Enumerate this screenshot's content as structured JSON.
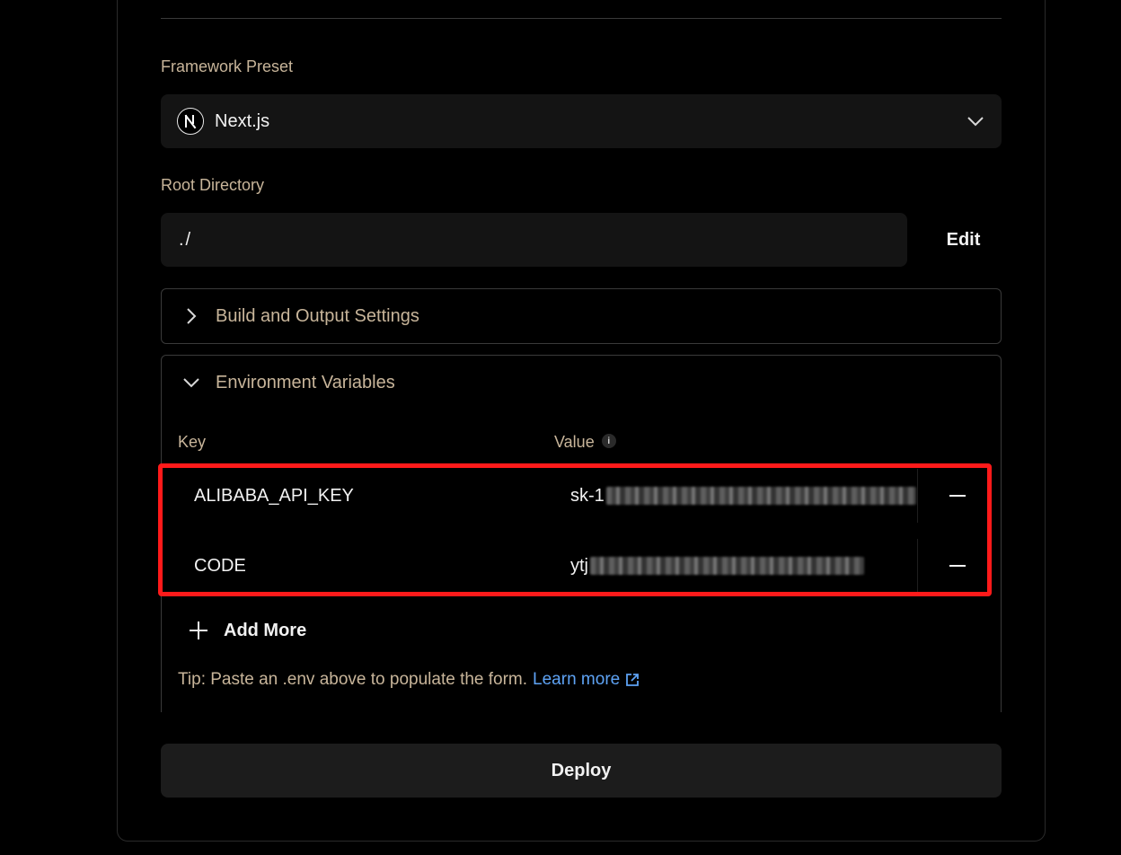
{
  "framework": {
    "label": "Framework Preset",
    "selected": "Next.js",
    "logo_icon": "nextjs-logo-icon"
  },
  "root_directory": {
    "label": "Root Directory",
    "value": "./",
    "edit_label": "Edit"
  },
  "build_settings": {
    "title": "Build and Output Settings",
    "expanded": false
  },
  "env": {
    "title": "Environment Variables",
    "expanded": true,
    "key_header": "Key",
    "value_header": "Value",
    "rows": [
      {
        "key": "ALIBABA_API_KEY",
        "value_visible": "sk-1"
      },
      {
        "key": "CODE",
        "value_visible": "ytj"
      }
    ],
    "add_more_label": "Add More",
    "tip_text": "Tip: Paste an .env above to populate the form.",
    "tip_link": "Learn more"
  },
  "deploy_label": "Deploy",
  "colors": {
    "accent_label": "#c8b59a",
    "link": "#5ea3f5",
    "highlight": "#ff1a1a"
  }
}
